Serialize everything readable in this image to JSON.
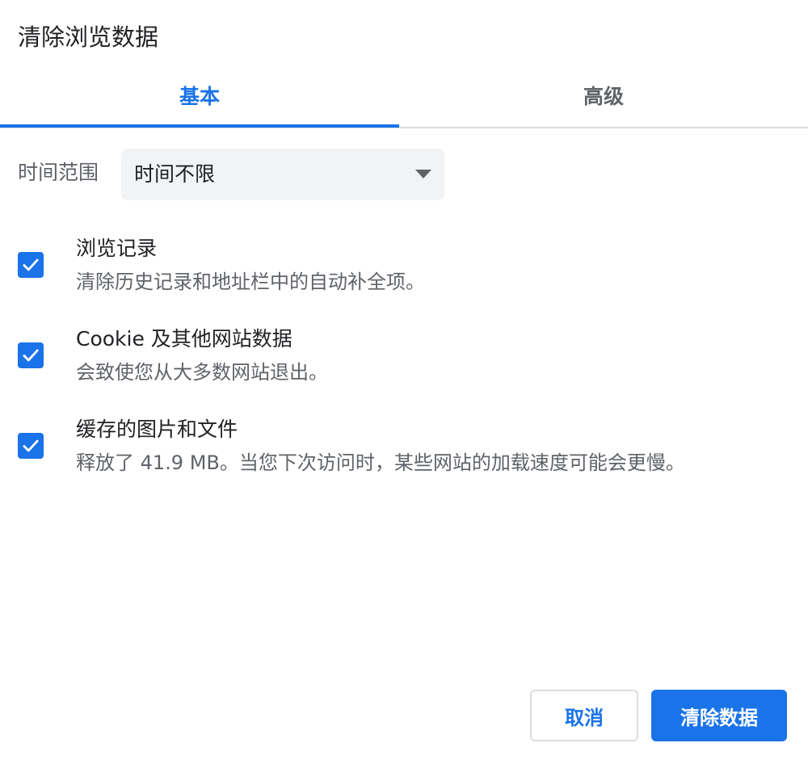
{
  "dialog": {
    "title": "清除浏览数据"
  },
  "tabs": [
    {
      "label": "基本",
      "active": true
    },
    {
      "label": "高级",
      "active": false
    }
  ],
  "time_range": {
    "label": "时间范围",
    "value": "时间不限"
  },
  "options": [
    {
      "title": "浏览记录",
      "description": "清除历史记录和地址栏中的自动补全项。",
      "checked": true
    },
    {
      "title": "Cookie 及其他网站数据",
      "description": "会致使您从大多数网站退出。",
      "checked": true
    },
    {
      "title": "缓存的图片和文件",
      "description": "释放了 41.9 MB。当您下次访问时，某些网站的加载速度可能会更慢。",
      "checked": true
    }
  ],
  "buttons": {
    "cancel_label": "取消",
    "clear_label": "清除数据"
  },
  "colors": {
    "accent": "#1a73e8",
    "select_bg": "#f1f3f4",
    "secondary_text": "#5f6368"
  }
}
